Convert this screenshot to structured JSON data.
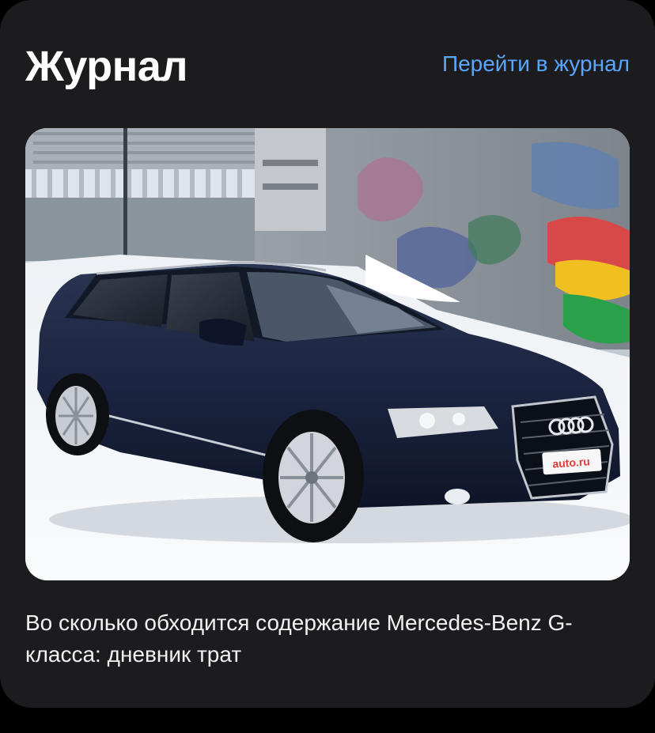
{
  "journal": {
    "title": "Журнал",
    "go_to_journal_link": "Перейти в журнал",
    "article": {
      "image_alt": "Audi A6 Avant",
      "plate_text": "auto.ru",
      "headline": "Во сколько обходится содержание Mercedes-Benz G-класса: дневник трат"
    }
  },
  "colors": {
    "card_background": "#1c1c1e",
    "link": "#5aa6ff",
    "title": "#ffffff"
  }
}
